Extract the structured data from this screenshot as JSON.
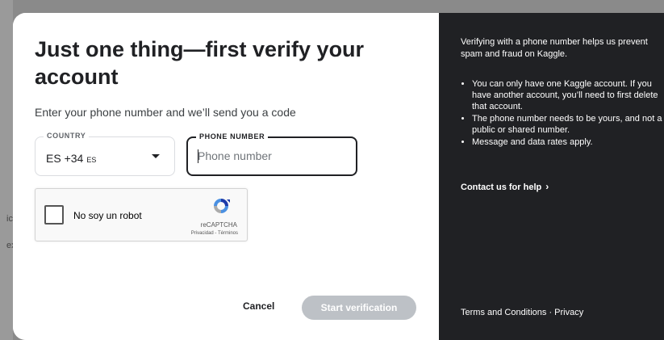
{
  "backdrop": {
    "fragment_1": "ic",
    "fragment_2": "ex"
  },
  "modal": {
    "title": "Just one thing—first verify your account",
    "subtitle": "Enter your phone number and we’ll send you a code",
    "country": {
      "label": "COUNTRY",
      "value": "ES +34",
      "code": "ES"
    },
    "phone": {
      "label": "PHONE NUMBER",
      "placeholder": "Phone number",
      "value": ""
    },
    "recaptcha": {
      "label": "No soy un robot",
      "brand": "reCAPTCHA",
      "privacy": "Privacidad",
      "separator": " - ",
      "terms": "Términos",
      "checked": false
    },
    "buttons": {
      "cancel": "Cancel",
      "start": "Start verification"
    }
  },
  "sidebar": {
    "intro": "Verifying with a phone number helps us prevent spam and fraud on Kaggle.",
    "bullets": [
      "You can only have one Kaggle account. If you have another account, you’ll need to first delete that account.",
      "The phone number needs to be yours, and not a public or shared number.",
      "Message and data rates apply."
    ],
    "contact_link": "Contact us for help",
    "footer": {
      "terms": "Terms and Conditions",
      "separator": " · ",
      "privacy": "Privacy"
    }
  },
  "colors": {
    "sidebar_bg": "#202124",
    "button_disabled": "#bdc1c6",
    "text_primary": "#202124"
  }
}
